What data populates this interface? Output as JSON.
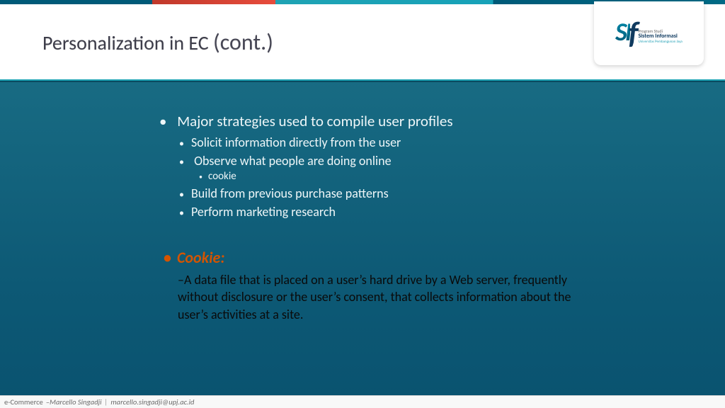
{
  "title": {
    "main": "Personalization in EC ",
    "cont": "(cont.)"
  },
  "logo": {
    "abbr": "SI",
    "f": "f",
    "line1": "Program Studi",
    "line2": "Sistem Informasi",
    "line3": "Universitas Pembangunan Jaya"
  },
  "bullets": {
    "heading": "Major strategies used to compile user profiles",
    "items": [
      "Solicit information directly from the user",
      "Observe what people are doing online",
      "Build from previous purchase patterns",
      "Perform marketing research"
    ],
    "sub_of_1": "cookie"
  },
  "cookie": {
    "label": "Cookie:",
    "definition": "–A data file that is placed on a user’s hard drive by a Web server, frequently without disclosure or the user’s consent, that collects information about the user’s activities at a site."
  },
  "footer": {
    "course": "e-Commerce",
    "dash": " – ",
    "author": "Marcello Singadji",
    "sep": "|",
    "email": "marcello.singadji@upj.ac.id"
  }
}
